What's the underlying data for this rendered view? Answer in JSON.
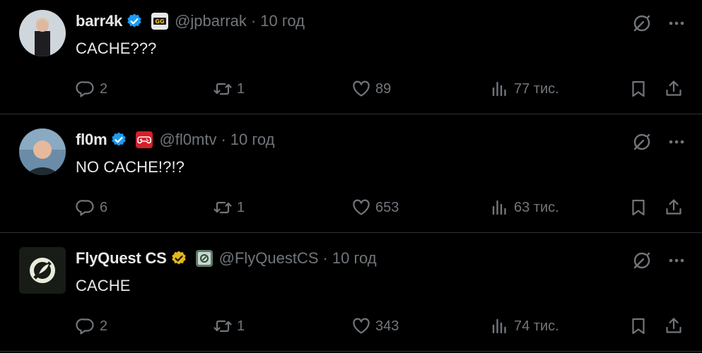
{
  "tweets": [
    {
      "name": "barr4k",
      "handle": "@jpbarrak",
      "time": "10 год",
      "text": "CACHE???",
      "verified_color": "#1d9bf0",
      "affiliation_icon": "team-logo-icon",
      "stats": {
        "replies": "2",
        "retweets": "1",
        "likes": "89",
        "views": "77 тис."
      }
    },
    {
      "name": "fl0m",
      "handle": "@fl0mtv",
      "time": "10 год",
      "text": "NO CACHE!?!?",
      "verified_color": "#1d9bf0",
      "affiliation_icon": "gamepad-icon",
      "stats": {
        "replies": "6",
        "retweets": "1",
        "likes": "653",
        "views": "63 тис."
      }
    },
    {
      "name": "FlyQuest CS",
      "handle": "@FlyQuestCS",
      "time": "10 год",
      "text": "CACHE",
      "verified_color": "#e2b719",
      "affiliation_icon": "flyquest-org-icon",
      "stats": {
        "replies": "2",
        "retweets": "1",
        "likes": "343",
        "views": "74 тис."
      }
    }
  ],
  "separator": "·",
  "colors": {
    "background": "#000000",
    "text_primary": "#e7e9ea",
    "text_secondary": "#71767b",
    "divider": "#2f3336",
    "verified_blue": "#1d9bf0",
    "verified_gold": "#e2b719"
  }
}
